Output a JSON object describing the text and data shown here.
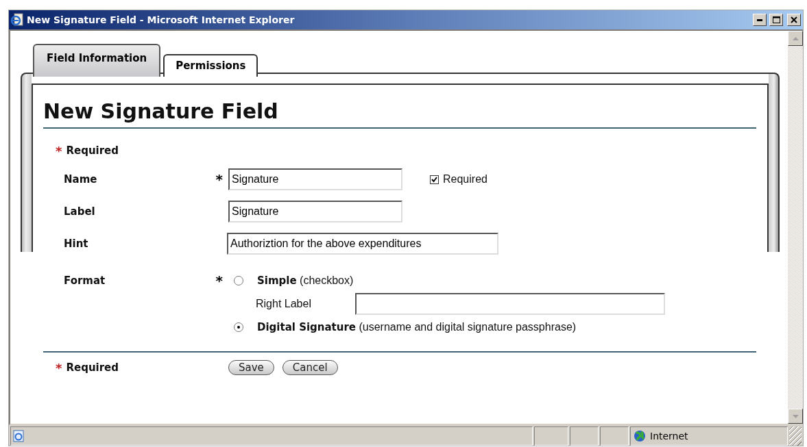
{
  "window": {
    "title": "New Signature Field - Microsoft Internet Explorer"
  },
  "tabs": [
    {
      "label": "Field Information",
      "selected": true
    },
    {
      "label": "Permissions",
      "selected": false
    }
  ],
  "heading": "New Signature Field",
  "required_note_top": {
    "mark": "*",
    "text": "Required"
  },
  "fields": [
    {
      "label": "Name",
      "required": true,
      "value": "Signature",
      "checkbox": {
        "label": "Required",
        "checked": true
      }
    },
    {
      "label": "Label",
      "required": false,
      "value": "Signature"
    },
    {
      "label": "Hint",
      "required": false,
      "value": "Authoriztion for the above expenditures"
    }
  ],
  "format": {
    "label": "Format",
    "required": true,
    "options": [
      {
        "title": "Simple",
        "detail": "(checkbox)",
        "selected": false,
        "sub_field": {
          "label": "Right Label"
        }
      },
      {
        "title": "Digital Signature",
        "detail": "(username and digital signature passphrase)",
        "selected": true
      }
    ]
  },
  "required_note_bottom": {
    "mark": "*",
    "text": "Required"
  },
  "buttons": [
    "Save",
    "Cancel"
  ],
  "status_bar": {
    "zone": "Internet"
  }
}
